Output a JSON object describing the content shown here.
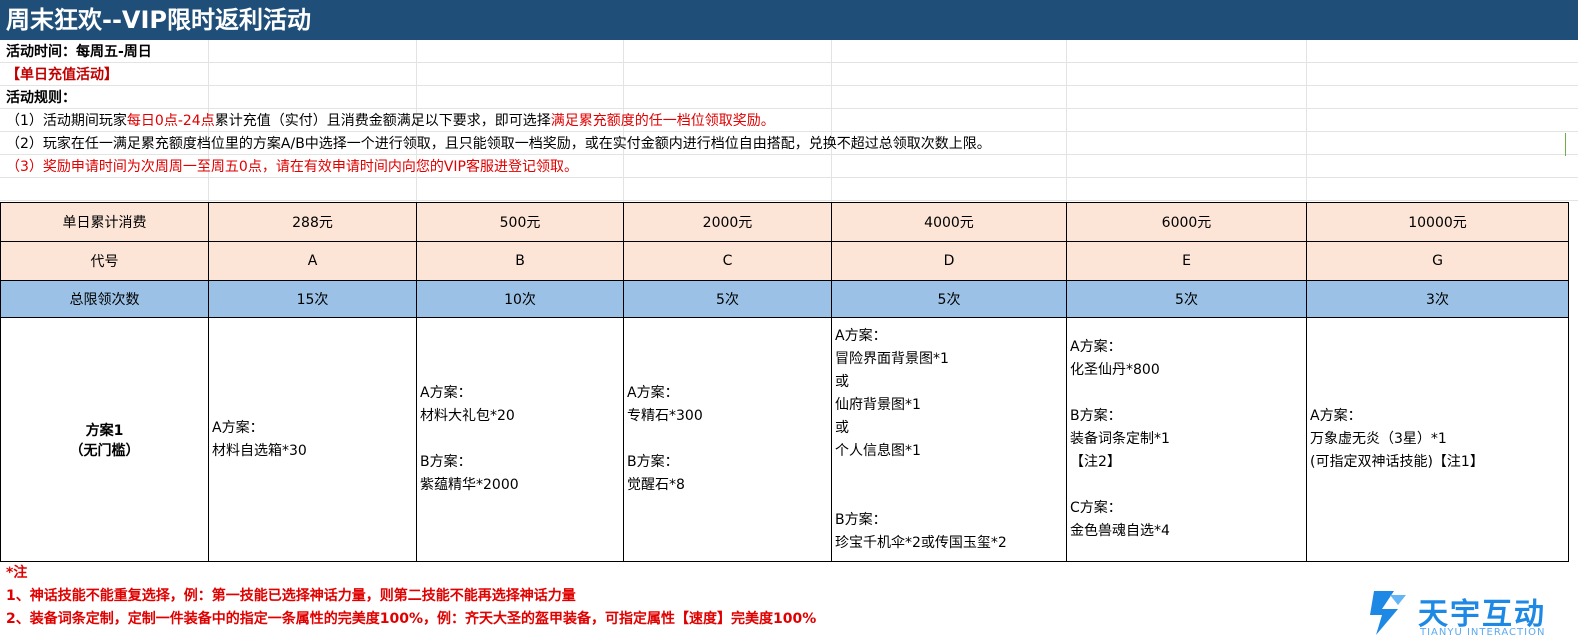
{
  "title": "周末狂欢--VIP限时返利活动",
  "info": {
    "time": "活动时间：每周五-周日",
    "section": "【单日充值活动】",
    "rules_heading": "活动规则：",
    "rule1": {
      "a": "（1）活动期间玩家",
      "b": "每日0点-24点",
      "c": "累计充值（实付）且消费金额满足以下要求，即可选择",
      "d": "满足累充额度的任一档位领取奖励。"
    },
    "rule2": "（2）玩家在任一满足累充额度档位里的方案A/B中选择一个进行领取，且只能领取一档奖励，或在实付金额内进行档位自由搭配，兑换不超过总领取次数上限。",
    "rule3": "（3）奖励申请时间为次周周一至周五0点，请在有效申请时间内向您的VIP客服进登记领取。"
  },
  "table": {
    "row_spend": {
      "label": "单日累计消费",
      "values": [
        "288元",
        "500元",
        "2000元",
        "4000元",
        "6000元",
        "10000元"
      ]
    },
    "row_code": {
      "label": "代号",
      "values": [
        "A",
        "B",
        "C",
        "D",
        "E",
        "G"
      ]
    },
    "row_limit": {
      "label": "总限领次数",
      "values": [
        "15次",
        "10次",
        "5次",
        "5次",
        "5次",
        "3次"
      ]
    },
    "row_plan": {
      "label_line1": "方案1",
      "label_line2": "（无门槛）",
      "cells": [
        [
          "A方案：",
          "材料自选箱*30"
        ],
        [
          "A方案：",
          "材料大礼包*20",
          "",
          "B方案：",
          "紫蕴精华*2000"
        ],
        [
          "A方案：",
          "专精石*300",
          "",
          "B方案：",
          "觉醒石*8"
        ],
        [
          "A方案：",
          "冒险界面背景图*1",
          "或",
          "仙府背景图*1",
          "或",
          "个人信息图*1",
          "",
          "",
          "B方案：",
          "珍宝千机伞*2或传国玉玺*2"
        ],
        [
          "A方案：",
          "化圣仙丹*800",
          "",
          "B方案：",
          "装备词条定制*1",
          "【注2】",
          "",
          "C方案：",
          "金色兽魂自选*4"
        ],
        [
          "A方案：",
          "万象虚无炎（3星）*1",
          "(可指定双神话技能)【注1】"
        ]
      ]
    }
  },
  "notes": {
    "heading": "*注",
    "note1": "1、神话技能不能重复选择，例：第一技能已选择神话力量，则第二技能不能再选择神话力量",
    "note2": "2、装备词条定制，定制一件装备中的指定一条属性的完美度100%，例：齐天大圣的盔甲装备，可指定属性【速度】完美度100%"
  },
  "logo": {
    "text": "天宇互动",
    "sub": "TIANYU INTERACTION",
    "color": "#1e88e5"
  }
}
